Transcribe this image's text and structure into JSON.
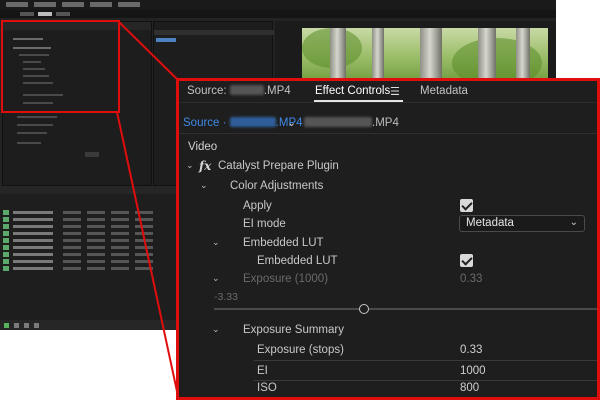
{
  "effect_controls": {
    "tabs": {
      "source_prefix": "Source:",
      "source_suffix": ".MP4",
      "effect_controls": "Effect Controls",
      "metadata": "Metadata"
    },
    "source_row": {
      "left_prefix": "Source ·",
      "left_suffix": ".MP4",
      "right_suffix": ".MP4"
    },
    "section": "Video",
    "plugin": "Catalyst Prepare Plugin",
    "color_adjustments": "Color Adjustments",
    "apply_label": "Apply",
    "apply_checked": true,
    "ei_mode_label": "EI mode",
    "ei_mode_value": "Metadata",
    "embedded_lut_group": "Embedded LUT",
    "embedded_lut_label": "Embedded LUT",
    "embedded_lut_checked": true,
    "exposure_label": "Exposure (1000)",
    "exposure_value": "0.33",
    "exposure_min": "-3.33",
    "exposure_summary": "Exposure Summary",
    "summary": [
      {
        "label": "Exposure (stops)",
        "value": "0.33"
      },
      {
        "label": "EI",
        "value": "1000"
      },
      {
        "label": "ISO",
        "value": "800"
      }
    ]
  },
  "colors": {
    "highlight": "#e00d0d",
    "accent_blue": "#3f8ae8",
    "panel_bg": "#1e1e1e"
  },
  "icons": [
    "menu-icon",
    "chevron-down-icon",
    "fx-icon",
    "checkbox-icon",
    "slider-thumb-icon",
    "disclosure-arrow-icon"
  ]
}
